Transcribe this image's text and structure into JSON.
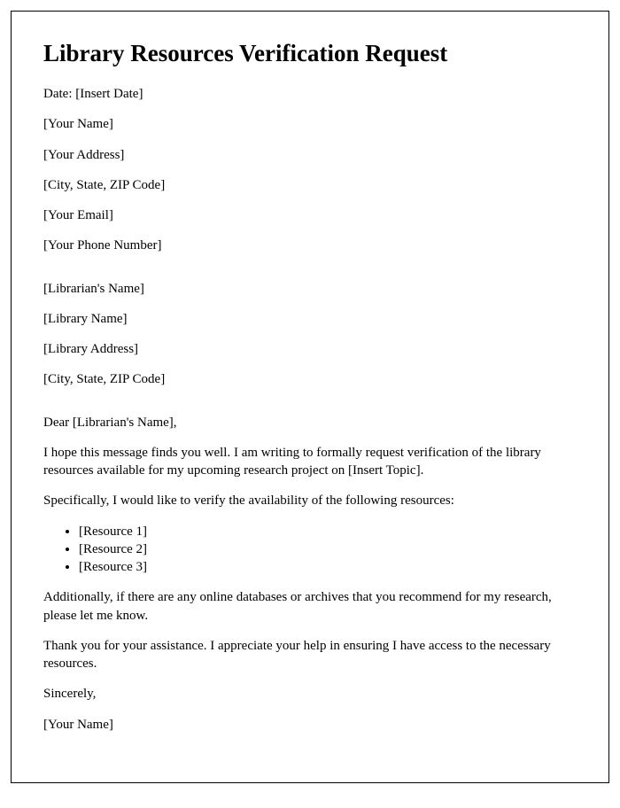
{
  "title": "Library Resources Verification Request",
  "sender": {
    "date_line": "Date: [Insert Date]",
    "name": "[Your Name]",
    "address": "[Your Address]",
    "city_line": "[City, State, ZIP Code]",
    "email": "[Your Email]",
    "phone": "[Your Phone Number]"
  },
  "recipient": {
    "name": "[Librarian's Name]",
    "library": "[Library Name]",
    "address": "[Library Address]",
    "city_line": "[City, State, ZIP Code]"
  },
  "salutation": "Dear [Librarian's Name],",
  "body": {
    "p1": "I hope this message finds you well. I am writing to formally request verification of the library resources available for my upcoming research project on [Insert Topic].",
    "p2": "Specifically, I would like to verify the availability of the following resources:",
    "resources": [
      "[Resource 1]",
      "[Resource 2]",
      "[Resource 3]"
    ],
    "p3": "Additionally, if there are any online databases or archives that you recommend for my research, please let me know.",
    "p4": "Thank you for your assistance. I appreciate your help in ensuring I have access to the necessary resources."
  },
  "closing": "Sincerely,",
  "signature": "[Your Name]"
}
